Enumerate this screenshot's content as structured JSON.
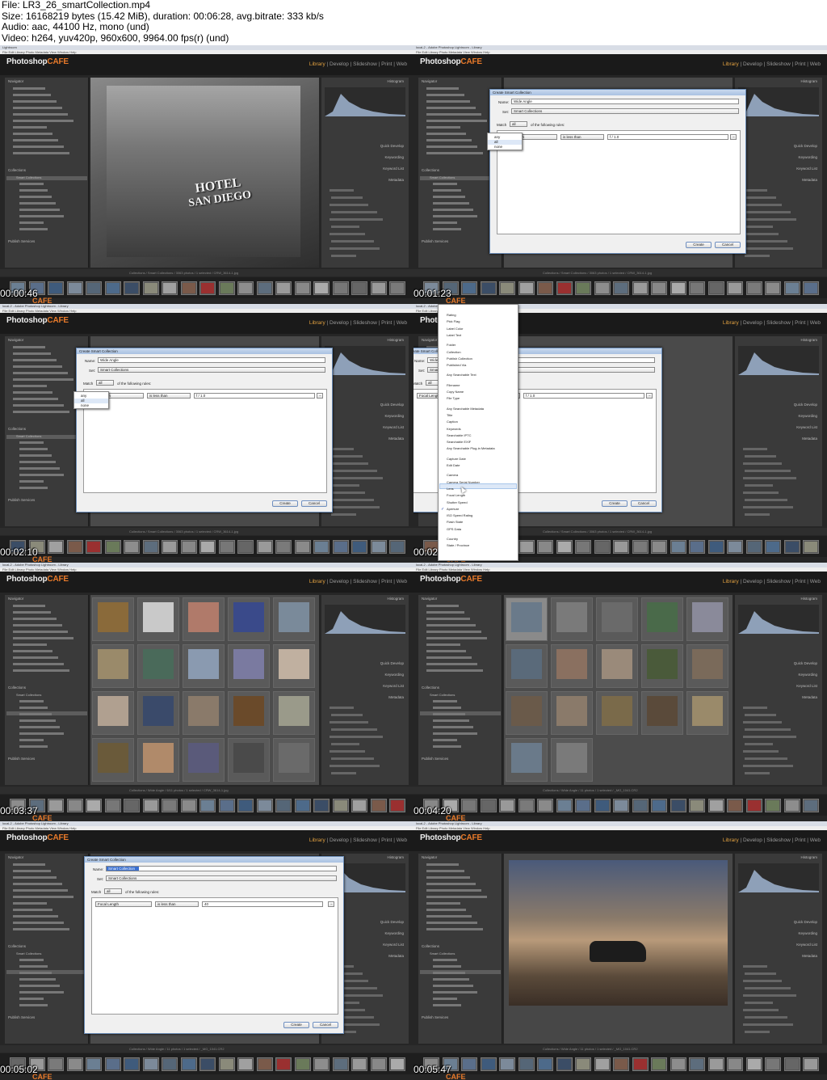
{
  "file_info": {
    "line1": "File: LR3_26_smartCollection.mp4",
    "line2": "Size: 16168219 bytes (15.42 MiB), duration: 00:06:28, avg.bitrate: 333 kb/s",
    "line3": "Audio: aac, 44100 Hz, mono (und)",
    "line4": "Video: h264, yuv420p, 960x600, 9964.00 fps(r) (und)"
  },
  "app": {
    "brand_main": "Photoshop",
    "brand_accent": "CAFE",
    "bottom_brand": "CAFE",
    "modules_prefix": "",
    "module_active": "Library",
    "module_rest": " | Develop | Slideshow | Print | Web",
    "titlebar_1": "Lightroom",
    "titlebar_2": "local-2 - Adobe Photoshop Lightroom - Library",
    "menu": "File  Edit  Library  Photo  Metadata  View  Window  Help",
    "left_panel": {
      "navigator": "Navigator",
      "collections": "Collections",
      "publish": "Publish Services",
      "smart_collections": "Smart Collections"
    },
    "right_panel": {
      "histogram": "Histogram",
      "quick_develop": "Quick Develop",
      "keywording": "Keywording",
      "keyword_list": "Keyword List",
      "metadata": "Metadata"
    }
  },
  "frames": [
    {
      "timestamp": "00:00:46",
      "toolbar_text": "Collections / Smart Collections / 3063 photos / 1 selected / CRW_3614-1.jpg"
    },
    {
      "timestamp": "00:01:23",
      "toolbar_text": "Collections / Smart Collections / 3063 photos / 1 selected / CRW_3614-1.jpg"
    },
    {
      "timestamp": "00:02:10",
      "toolbar_text": "Collections / Smart Collections / 3063 photos / 1 selected / CRW_3614-1.jpg"
    },
    {
      "timestamp": "00:02:52",
      "toolbar_text": "Collections / Smart Collections / 3063 photos / 1 selected / CRW_3614-1.jpg"
    },
    {
      "timestamp": "00:03:37",
      "toolbar_text": "Collections / Wide Angle / 6/11 photos / 1 selected / CRW_3614-1.jpg"
    },
    {
      "timestamp": "00:04:20",
      "toolbar_text": "Collections / Wide Angle / 11 photos / 1 selected / _MG_1041.CR2"
    },
    {
      "timestamp": "00:05:02",
      "toolbar_text": "Collections / Wide Angle / 11 photos / 1 selected / _MG_1041.CR2"
    },
    {
      "timestamp": "00:05:47",
      "toolbar_text": "Collections / Wide Angle / 11 photos / 1 selected / _MG_1041.CR2"
    }
  ],
  "hotel_sign": {
    "line1": "HOTEL",
    "line2": "SAN DIEGO"
  },
  "dialog": {
    "title": "Create Smart Collection",
    "name_label": "Name:",
    "name_value": "Wide Angle",
    "name_value_new": "Smart Collection",
    "set_label": "Set:",
    "set_value": "Smart Collections",
    "match_label": "Match",
    "match_value": "all",
    "match_suffix": "of the following rules:",
    "rule_field": "Focal Length",
    "rule_op": "is less than",
    "rule_value": "f / 1.0",
    "rule_value_2": "40",
    "create": "Create",
    "cancel": "Cancel",
    "match_options": [
      "any",
      "all",
      "none"
    ]
  },
  "rule_menu": [
    "Rating",
    "Pick Flag",
    "Label Color",
    "Label Text",
    "Folder",
    "Collection",
    "Publish Collection",
    "Published Via",
    "Any Searchable Text",
    "Filename",
    "Copy Name",
    "File Type",
    "Any Searchable Metadata",
    "Title",
    "Caption",
    "Keywords",
    "Searchable IPTC",
    "Searchable EXIF",
    "Any Searchable Plug-in Metadata",
    "Capture Date",
    "Edit Date",
    "Camera",
    "Camera Serial Number",
    "Lens",
    "Focal Length",
    "Shutter Speed",
    "Aperture",
    "ISO Speed Rating",
    "Flash State",
    "GPS Data",
    "Country",
    "State / Province"
  ],
  "colors": {
    "accent": "#e87a2a",
    "lr_dark": "#262626",
    "panel": "#3a3a3a",
    "dialog": "#f0f0f0"
  }
}
